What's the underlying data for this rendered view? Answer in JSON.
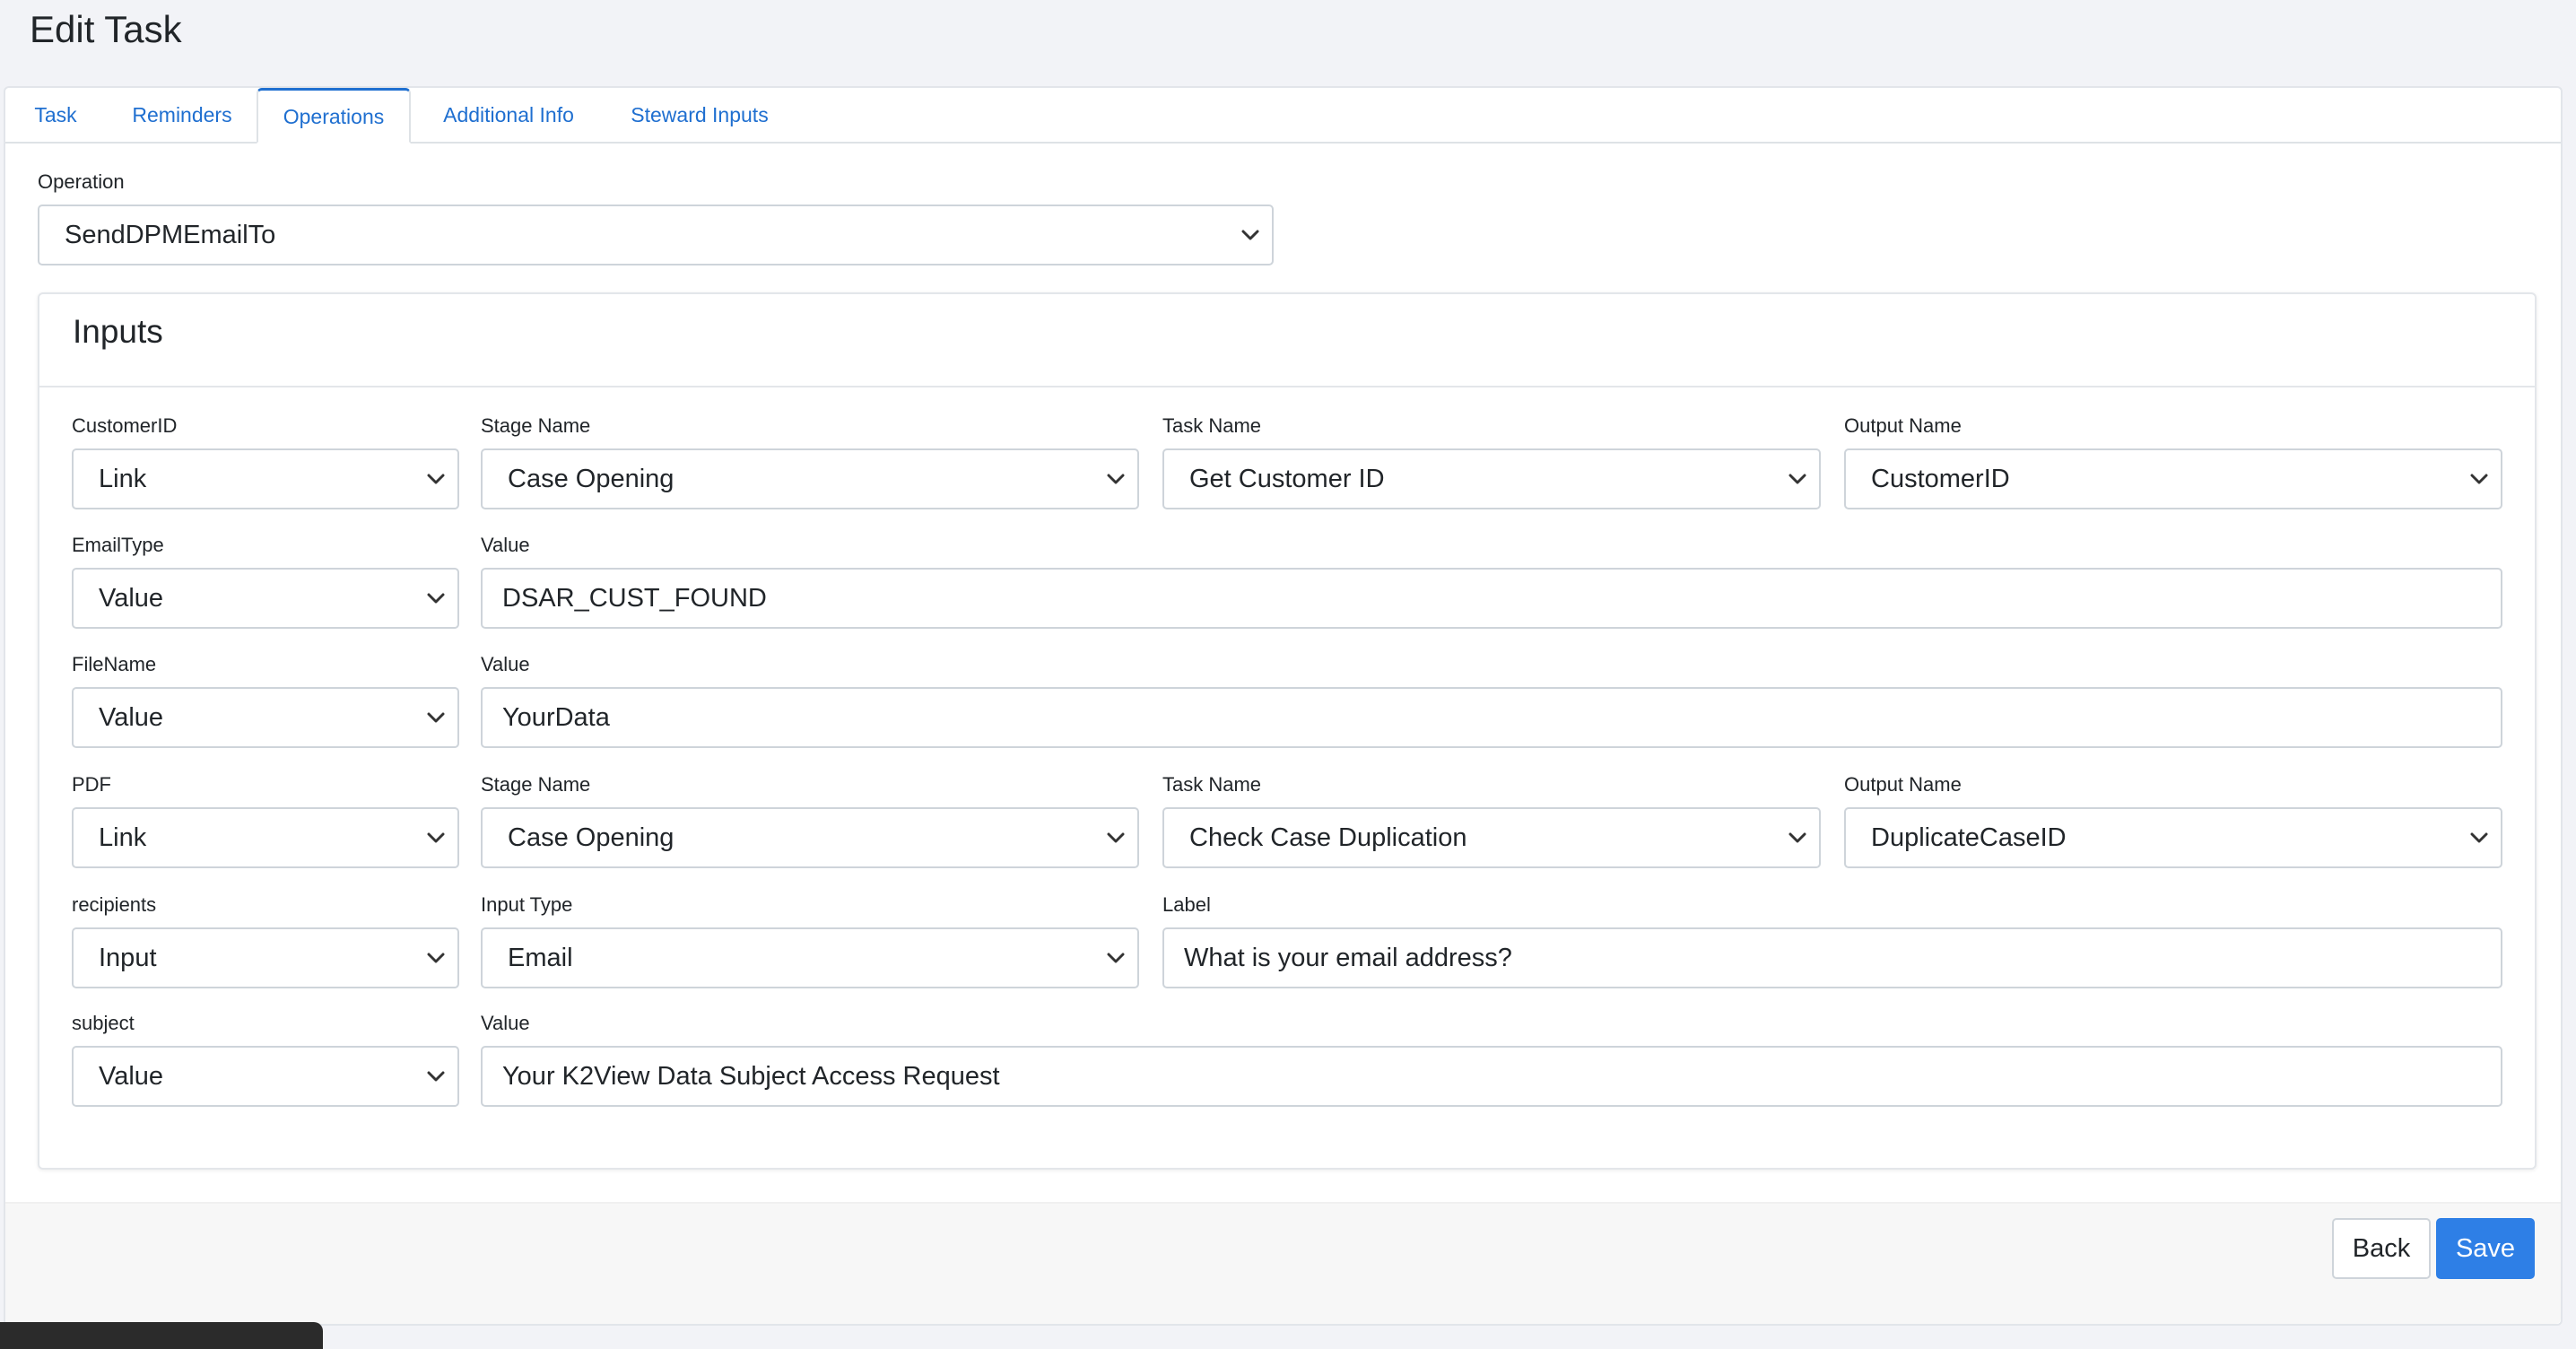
{
  "page": {
    "title": "Edit Task"
  },
  "tabs": [
    {
      "label": "Task",
      "active": false
    },
    {
      "label": "Reminders",
      "active": false
    },
    {
      "label": "Operations",
      "active": true
    },
    {
      "label": "Additional Info",
      "active": false
    },
    {
      "label": "Steward Inputs",
      "active": false
    }
  ],
  "operation": {
    "label": "Operation",
    "value": "SendDPMEmailTo"
  },
  "inputs": {
    "title": "Inputs",
    "rows": [
      {
        "name": "CustomerID",
        "mode": "Link",
        "stage_label": "Stage Name",
        "stage": "Case Opening",
        "task_label": "Task Name",
        "task": "Get Customer ID",
        "output_label": "Output Name",
        "output": "CustomerID"
      },
      {
        "name": "EmailType",
        "mode": "Value",
        "value_label": "Value",
        "value": "DSAR_CUST_FOUND"
      },
      {
        "name": "FileName",
        "mode": "Value",
        "value_label": "Value",
        "value": "YourData"
      },
      {
        "name": "PDF",
        "mode": "Link",
        "stage_label": "Stage Name",
        "stage": "Case Opening",
        "task_label": "Task Name",
        "task": "Check Case Duplication",
        "output_label": "Output Name",
        "output": "DuplicateCaseID"
      },
      {
        "name": "recipients",
        "mode": "Input",
        "input_type_label": "Input Type",
        "input_type": "Email",
        "field_label": "Label",
        "field_value": "What is your email address?"
      },
      {
        "name": "subject",
        "mode": "Value",
        "value_label": "Value",
        "value": "Your K2View Data Subject Access Request"
      }
    ]
  },
  "footer": {
    "back_label": "Back",
    "save_label": "Save"
  },
  "colors": {
    "accent": "#1f6fd0",
    "primary_button": "#2e7fe6",
    "page_bg": "#f2f3f7"
  }
}
